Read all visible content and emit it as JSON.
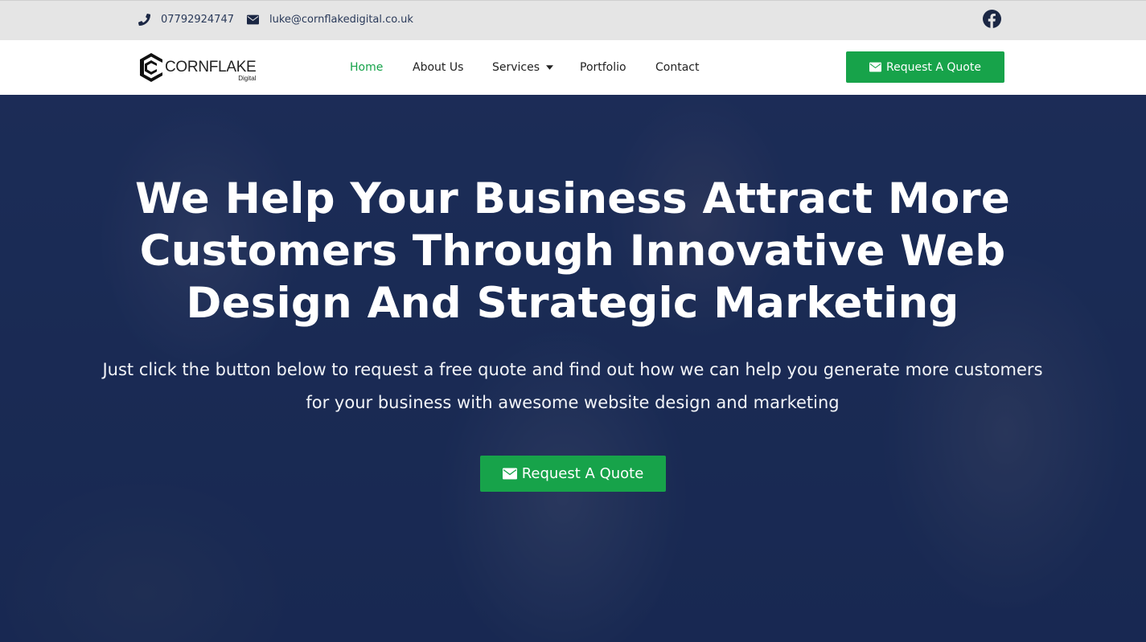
{
  "topbar": {
    "phone": "07792924747",
    "email": "luke@cornflakedigital.co.uk",
    "phone_icon": "phone-icon",
    "email_icon": "envelope-icon",
    "social_icon": "facebook-icon"
  },
  "header": {
    "logo_word": "CORNFLAKE",
    "logo_sub": "Digital",
    "nav": {
      "home": "Home",
      "about": "About Us",
      "services": "Services",
      "portfolio": "Portfolio",
      "contact": "Contact"
    },
    "quote_button": "Request A Quote"
  },
  "hero": {
    "title": "We Help Your Business Attract More Customers Through Innovative Web Design And Strategic Marketing",
    "subtitle": "Just click the button below to request a free quote and find out how we can help you generate more customers for your business with awesome website design and marketing",
    "quote_button": "Request A Quote"
  },
  "colors": {
    "accent": "#17a34a",
    "topbar_bg": "#e5e5e5",
    "hero_overlay": "#1c2c52",
    "active_nav": "#16a34a"
  }
}
